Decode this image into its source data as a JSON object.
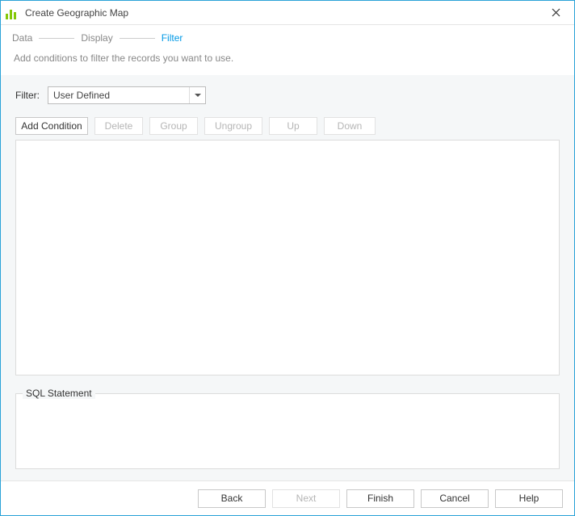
{
  "window": {
    "title": "Create Geographic Map"
  },
  "steps": {
    "data": "Data",
    "display": "Display",
    "filter": "Filter",
    "activeIndex": 2
  },
  "hint": "Add conditions to filter the records you want to use.",
  "filter": {
    "label": "Filter:",
    "value": "User Defined"
  },
  "toolbar": {
    "addCondition": "Add Condition",
    "delete": "Delete",
    "group": "Group",
    "ungroup": "Ungroup",
    "up": "Up",
    "down": "Down"
  },
  "sql": {
    "legend": "SQL Statement",
    "value": ""
  },
  "footer": {
    "back": "Back",
    "next": "Next",
    "finish": "Finish",
    "cancel": "Cancel",
    "help": "Help"
  }
}
